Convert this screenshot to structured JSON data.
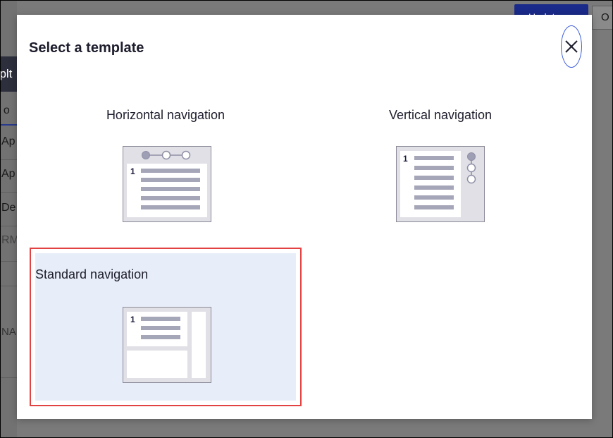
{
  "background": {
    "header_fragment": "nplt",
    "select_fragment": "t o",
    "rows": [
      "Ap",
      "Ap",
      "De",
      "RM"
    ],
    "side_fragment": "NA",
    "primary_button_fragment": "Update",
    "secondary_button_fragment": "O",
    "primary_color": "#1a2a8a"
  },
  "modal": {
    "title": "Select a template",
    "close_icon": "close-icon",
    "close_focus_color": "#3b5cdb",
    "options": [
      {
        "id": "horizontal",
        "label": "Horizontal navigation",
        "selected": false,
        "step_number": "1"
      },
      {
        "id": "vertical",
        "label": "Vertical navigation",
        "selected": false,
        "step_number": "1"
      },
      {
        "id": "standard",
        "label": "Standard navigation",
        "selected": true,
        "step_number": "1"
      }
    ],
    "selected_border_color": "#e34242",
    "selected_fill_color": "#e8eef9"
  }
}
